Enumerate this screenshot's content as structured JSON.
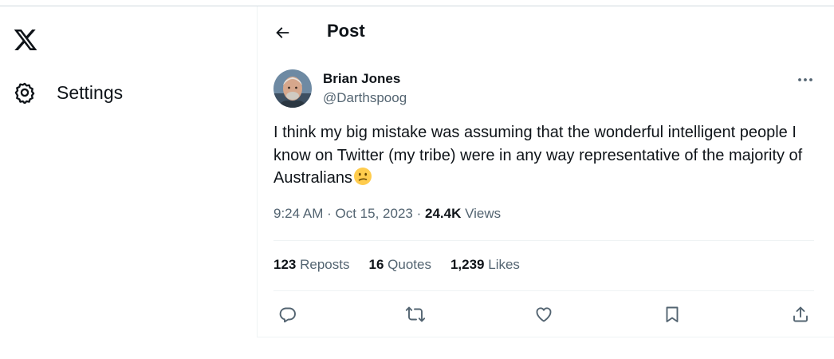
{
  "sidebar": {
    "logo_icon": "x-logo-icon",
    "settings": {
      "icon": "gear-icon",
      "label": "Settings"
    }
  },
  "header": {
    "back_icon": "arrow-left-icon",
    "title": "Post"
  },
  "post": {
    "author": {
      "name": "Brian Jones",
      "handle": "@Darthspoog"
    },
    "text": "I think my big mistake was assuming that the wonderful intelligent people I know on Twitter (my tribe) were in any way representative of the majority of Australians",
    "emoji": "confused-face-emoji",
    "time": "9:24 AM",
    "date": "Oct 15, 2023",
    "separator": "·",
    "views_count": "24.4K",
    "views_label": "Views",
    "stats": {
      "reposts_count": "123",
      "reposts_label": "Reposts",
      "quotes_count": "16",
      "quotes_label": "Quotes",
      "likes_count": "1,239",
      "likes_label": "Likes"
    }
  },
  "actions": [
    "reply-icon",
    "repost-icon",
    "like-icon",
    "bookmark-icon",
    "share-icon"
  ],
  "colors": {
    "text": "#0f1419",
    "secondary": "#536471",
    "divider": "#eff3f4"
  }
}
